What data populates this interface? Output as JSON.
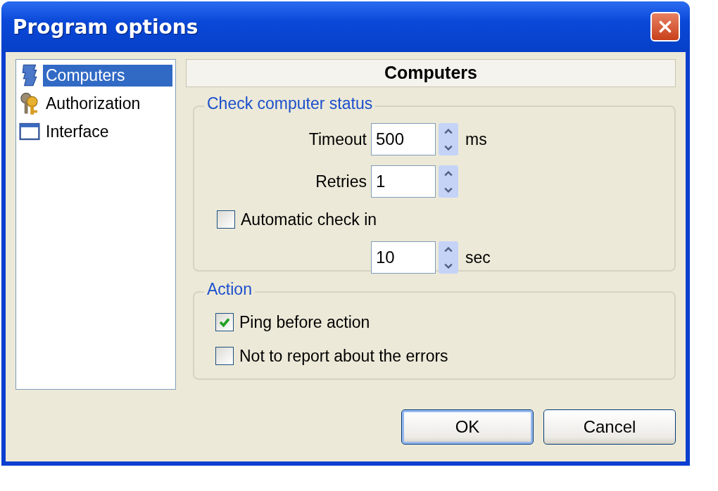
{
  "window": {
    "title": "Program options"
  },
  "sidebar": {
    "items": [
      {
        "label": "Computers",
        "selected": true
      },
      {
        "label": "Authorization",
        "selected": false
      },
      {
        "label": "Interface",
        "selected": false
      }
    ]
  },
  "panel": {
    "header": "Computers",
    "check_status": {
      "title": "Check computer status",
      "timeout": {
        "label": "Timeout",
        "value": "500",
        "unit": "ms"
      },
      "retries": {
        "label": "Retries",
        "value": "1"
      },
      "auto_check": {
        "label": "Automatic check in",
        "checked": false,
        "value": "10",
        "unit": "sec"
      }
    },
    "action": {
      "title": "Action",
      "options": [
        {
          "label": "Ping before action",
          "checked": true
        },
        {
          "label": "Not to report about the errors",
          "checked": false
        }
      ]
    }
  },
  "buttons": [
    {
      "label": "OK",
      "default": true
    },
    {
      "label": "Cancel",
      "default": false
    }
  ]
}
